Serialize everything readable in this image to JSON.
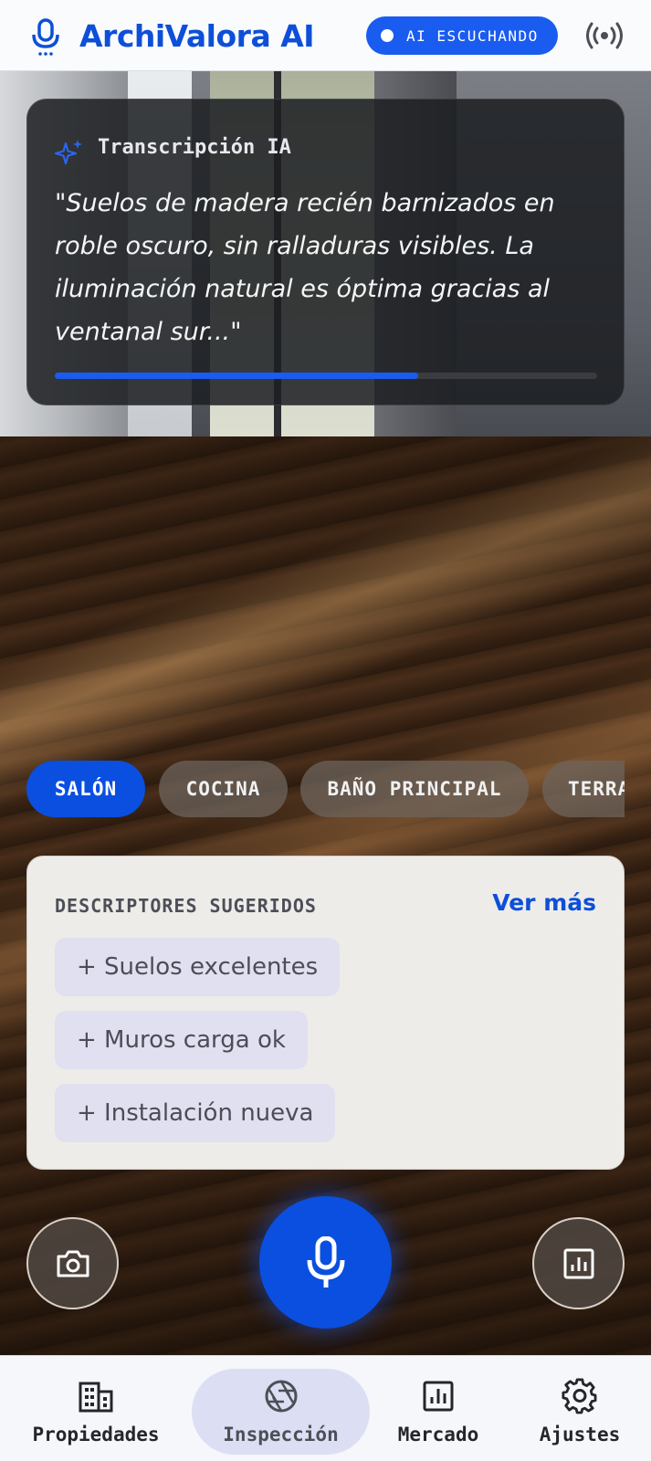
{
  "header": {
    "brand": "ArchiValora AI",
    "status_label": "AI ESCUCHANDO",
    "icons": [
      "mic-icon",
      "broadcast-icon"
    ]
  },
  "transcription": {
    "title": "Transcripción IA",
    "quote": "\"Suelos de madera recién barnizados en roble oscuro, sin ralladuras visibles. La iluminación natural es óptima gracias al ventanal sur...\"",
    "progress": 0.67,
    "icon": "sparkle-icon"
  },
  "rooms": [
    {
      "label": "SALÓN",
      "active": true
    },
    {
      "label": "COCINA",
      "active": false
    },
    {
      "label": "BAÑO PRINCIPAL",
      "active": false
    },
    {
      "label": "TERRAZA",
      "active": false
    }
  ],
  "descriptors": {
    "heading": "DESCRIPTORES SUGERIDOS",
    "more_link": "Ver más",
    "tags": [
      "+ Suelos excelentes",
      "+ Muros carga ok",
      "+ Instalación nueva"
    ]
  },
  "actions": {
    "camera_icon": "camera-icon",
    "record_icon": "mic-icon",
    "stats_icon": "analytics-icon"
  },
  "nav": [
    {
      "label": "Propiedades",
      "icon": "building-icon",
      "active": false
    },
    {
      "label": "Inspección",
      "icon": "aperture-icon",
      "active": true
    },
    {
      "label": "Mercado",
      "icon": "chart-icon",
      "active": false
    },
    {
      "label": "Ajustes",
      "icon": "gear-icon",
      "active": false
    }
  ],
  "colors": {
    "accent": "#0a4fe0",
    "brand": "#0d4fd8"
  }
}
